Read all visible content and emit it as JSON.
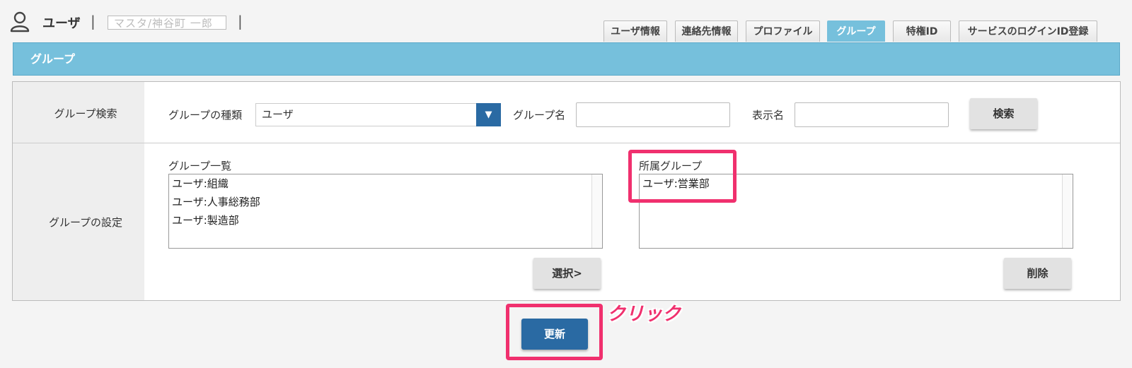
{
  "header": {
    "title": "ユーザ",
    "separator": "|",
    "name_value": "マスタ/神谷町 一郎"
  },
  "tabs": [
    {
      "label": "ユーザ情報",
      "active": false
    },
    {
      "label": "連絡先情報",
      "active": false
    },
    {
      "label": "プロファイル",
      "active": false
    },
    {
      "label": "グループ",
      "active": true
    },
    {
      "label": "特権ID",
      "active": false
    },
    {
      "label": "サービスのログインID登録",
      "active": false
    }
  ],
  "section_title": "グループ",
  "search": {
    "row_label": "グループ検索",
    "type_label": "グループの種類",
    "type_value": "ユーザ",
    "name_label": "グループ名",
    "name_value": "",
    "display_label": "表示名",
    "display_value": "",
    "search_button": "検索"
  },
  "settings": {
    "row_label": "グループの設定",
    "list_label": "グループ一覧",
    "list_items": [
      "ユーザ:組織",
      "ユーザ:人事総務部",
      "ユーザ:製造部"
    ],
    "select_button": "選択>",
    "member_label": "所属グループ",
    "member_items": [
      "ユーザ:営業部"
    ],
    "delete_button": "削除"
  },
  "update_button": "更新",
  "annotation": "クリック",
  "colors": {
    "accent": "#76c0dc",
    "primary_button": "#2a6aa3",
    "highlight": "#f0306e"
  }
}
